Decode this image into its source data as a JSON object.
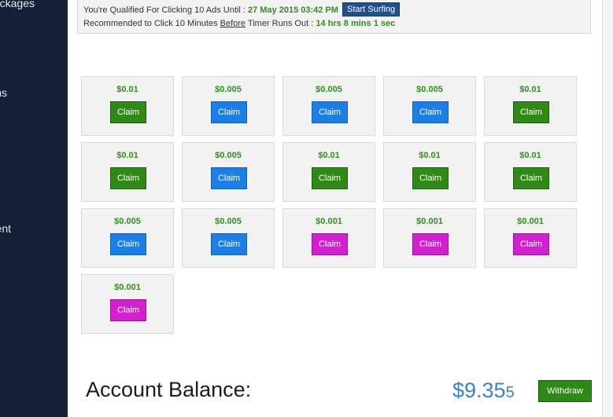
{
  "sidebar": {
    "items": [
      {
        "label": "ckages"
      },
      {
        "label": "ns"
      },
      {
        "label": "ent"
      }
    ]
  },
  "notice": {
    "line1_prefix": "You're Qualified For Clicking 10 Ads Until :",
    "line1_date": "27 May 2015 03:42 PM",
    "start_surfing_label": "Start Surfing",
    "line2_prefix": "Recommended to Click 10 Minutes",
    "line2_before": "Before",
    "line2_mid": "Timer Runs Out :",
    "line2_timer": "14 hrs 8 mins 1 sec"
  },
  "ads": [
    {
      "amount": "$0.01",
      "claim_label": "Claim",
      "color": "#2e8a14"
    },
    {
      "amount": "$0.005",
      "claim_label": "Claim",
      "color": "#1a7fe6"
    },
    {
      "amount": "$0.005",
      "claim_label": "Claim",
      "color": "#1a7fe6"
    },
    {
      "amount": "$0.005",
      "claim_label": "Claim",
      "color": "#1a7fe6"
    },
    {
      "amount": "$0.01",
      "claim_label": "Claim",
      "color": "#2e8a14"
    },
    {
      "amount": "$0.01",
      "claim_label": "Claim",
      "color": "#2e8a14"
    },
    {
      "amount": "$0.005",
      "claim_label": "Claim",
      "color": "#1a7fe6"
    },
    {
      "amount": "$0.01",
      "claim_label": "Claim",
      "color": "#2e8a14"
    },
    {
      "amount": "$0.01",
      "claim_label": "Claim",
      "color": "#2e8a14"
    },
    {
      "amount": "$0.01",
      "claim_label": "Claim",
      "color": "#2e8a14"
    },
    {
      "amount": "$0.005",
      "claim_label": "Claim",
      "color": "#1a7fe6"
    },
    {
      "amount": "$0.005",
      "claim_label": "Claim",
      "color": "#1a7fe6"
    },
    {
      "amount": "$0.001",
      "claim_label": "Claim",
      "color": "#d11fd1"
    },
    {
      "amount": "$0.001",
      "claim_label": "Claim",
      "color": "#d11fd1"
    },
    {
      "amount": "$0.001",
      "claim_label": "Claim",
      "color": "#d11fd1"
    },
    {
      "amount": "$0.001",
      "claim_label": "Claim",
      "color": "#d11fd1"
    }
  ],
  "balance": {
    "label": "Account Balance:",
    "value_main": "$9.35",
    "value_small": "5",
    "withdraw_label": "Withdraw"
  },
  "colors": {
    "sidebar_bg": "#152036",
    "accent_green": "#2f8f1f",
    "balance_blue": "#3a83c9"
  }
}
